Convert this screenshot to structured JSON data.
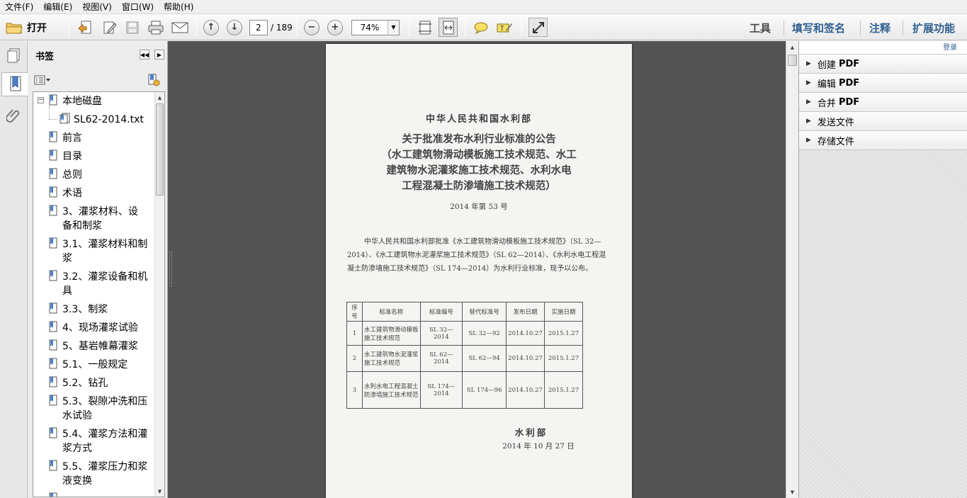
{
  "menu": [
    "文件(F)",
    "编辑(E)",
    "视图(V)",
    "窗口(W)",
    "帮助(H)"
  ],
  "toolbar": {
    "open_label": "打开",
    "page_current": "2",
    "page_total": "/ 189",
    "zoom": "74%",
    "links": {
      "tools": "工具",
      "fill_sign": "填写和签名",
      "comment": "注释",
      "extend": "扩展功能"
    }
  },
  "bookmarks": {
    "title": "书签",
    "items": [
      {
        "label": "本地磁盘"
      },
      {
        "label": "SL62-2014.txt"
      },
      {
        "label": "前言"
      },
      {
        "label": "目录"
      },
      {
        "label": "总则"
      },
      {
        "label": "术语"
      },
      {
        "label": "3、灌浆材料、设",
        "label2": "备和制浆"
      },
      {
        "label": "3.1、灌浆材料和制",
        "label2": "浆"
      },
      {
        "label": "3.2、灌浆设备和机",
        "label2": "具"
      },
      {
        "label": "3.3、制浆"
      },
      {
        "label": "4、现场灌浆试验"
      },
      {
        "label": "5、基岩帷幕灌浆"
      },
      {
        "label": "5.1、一般规定"
      },
      {
        "label": "5.2、钻孔"
      },
      {
        "label": "5.3、裂隙冲洗和压",
        "label2": "水试验"
      },
      {
        "label": "5.4、灌浆方法和灌",
        "label2": "浆方式"
      },
      {
        "label": "5.5、灌浆压力和浆",
        "label2": "液变换"
      }
    ]
  },
  "document": {
    "ministry": "中华人民共和国水利部",
    "title_lines": [
      "关于批准发布水利行业标准的公告",
      "（水工建筑物滑动模板施工技术规范、水工",
      "建筑物水泥灌浆施工技术规范、水利水电",
      "工程混凝土防渗墙施工技术规范）"
    ],
    "notice_no": "2014 年第 53 号",
    "body": "中华人民共和国水利部批准《水工建筑物滑动模板施工技术规范》（SL 32—2014）、《水工建筑物水泥灌浆施工技术规范》（SL 62—2014）、《水利水电工程混凝土防渗墙施工技术规范》（SL 174—2014）为水利行业标准，现予以公布。",
    "table": {
      "headers": [
        "序号",
        "标准名称",
        "标准编号",
        "替代标准号",
        "发布日期",
        "实施日期"
      ],
      "rows": [
        [
          "1",
          "水工建筑物滑动模板施工技术规范",
          "SL 32—2014",
          "SL 32—92",
          "2014.10.27",
          "2015.1.27"
        ],
        [
          "2",
          "水工建筑物水泥灌浆施工技术规范",
          "SL 62—2014",
          "SL 62—94",
          "2014.10.27",
          "2015.1.27"
        ],
        [
          "3",
          "水利水电工程混凝土防渗墙施工技术规范",
          "SL 174—2014",
          "SL 174—96",
          "2014.10.27",
          "2015.1.27"
        ]
      ]
    },
    "signature": "水利部",
    "date": "2014 年 10 月 27 日"
  },
  "right_panel": {
    "login": "登录",
    "items": [
      {
        "label": "创建",
        "suffix": "PDF"
      },
      {
        "label": "编辑",
        "suffix": "PDF"
      },
      {
        "label": "合并",
        "suffix": "PDF"
      },
      {
        "label": "发送文件",
        "suffix": ""
      },
      {
        "label": "存储文件",
        "suffix": ""
      }
    ]
  }
}
